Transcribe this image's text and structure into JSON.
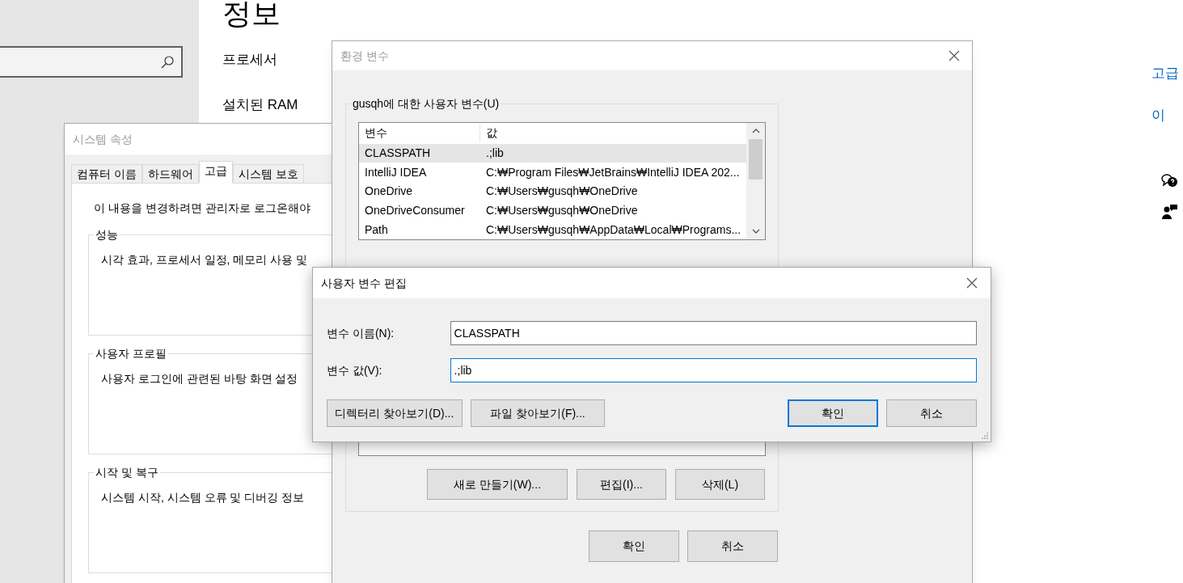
{
  "settings": {
    "heading": "정보",
    "spec_labels": [
      "프로세서",
      "설치된 RAM"
    ],
    "related_links": [
      "고급",
      "이"
    ]
  },
  "system_properties": {
    "title": "시스템 속성",
    "tabs": [
      {
        "label": "컴퓨터 이름",
        "selected": false
      },
      {
        "label": "하드웨어",
        "selected": false
      },
      {
        "label": "고급",
        "selected": true
      },
      {
        "label": "시스템 보호",
        "selected": false
      }
    ],
    "notice": "이 내용을 변경하려면 관리자로 로그온해야",
    "groups": [
      {
        "title": "성능",
        "description": "시각 효과, 프로세서 일정, 메모리 사용 및"
      },
      {
        "title": "사용자 프로필",
        "description": "사용자 로그인에 관련된 바탕 화면 설정"
      },
      {
        "title": "시작 및 복구",
        "description": "시스템 시작, 시스템 오류 및 디버깅 정보"
      }
    ]
  },
  "environment_variables": {
    "title": "환경 변수",
    "user_group_title": "gusqh에 대한 사용자 변수(U)",
    "columns": [
      "변수",
      "값"
    ],
    "rows": [
      {
        "name": "CLASSPATH",
        "value": ".;lib",
        "selected": true
      },
      {
        "name": "IntelliJ IDEA",
        "value": "C:₩Program Files₩JetBrains₩IntelliJ IDEA 202...",
        "selected": false
      },
      {
        "name": "OneDrive",
        "value": "C:₩Users₩gusqh₩OneDrive",
        "selected": false
      },
      {
        "name": "OneDriveConsumer",
        "value": "C:₩Users₩gusqh₩OneDrive",
        "selected": false
      },
      {
        "name": "Path",
        "value": "C:₩Users₩gusqh₩AppData₩Local₩Programs...",
        "selected": false
      }
    ],
    "system_buttons": [
      "새로 만들기(W)...",
      "편집(I)...",
      "삭제(L)"
    ],
    "buttons": [
      "확인",
      "취소"
    ]
  },
  "edit_dialog": {
    "title": "사용자 변수 편집",
    "fields": [
      {
        "label": "변수 이름(N):",
        "value": "CLASSPATH",
        "focused": false
      },
      {
        "label": "변수 값(V):",
        "value": ".;lib",
        "focused": true
      }
    ],
    "buttons": [
      {
        "label": "디렉터리 찾아보기(D)...",
        "default": false
      },
      {
        "label": "파일 찾아보기(F)...",
        "default": false
      },
      {
        "label": "확인",
        "default": true
      },
      {
        "label": "취소",
        "default": false
      }
    ]
  }
}
